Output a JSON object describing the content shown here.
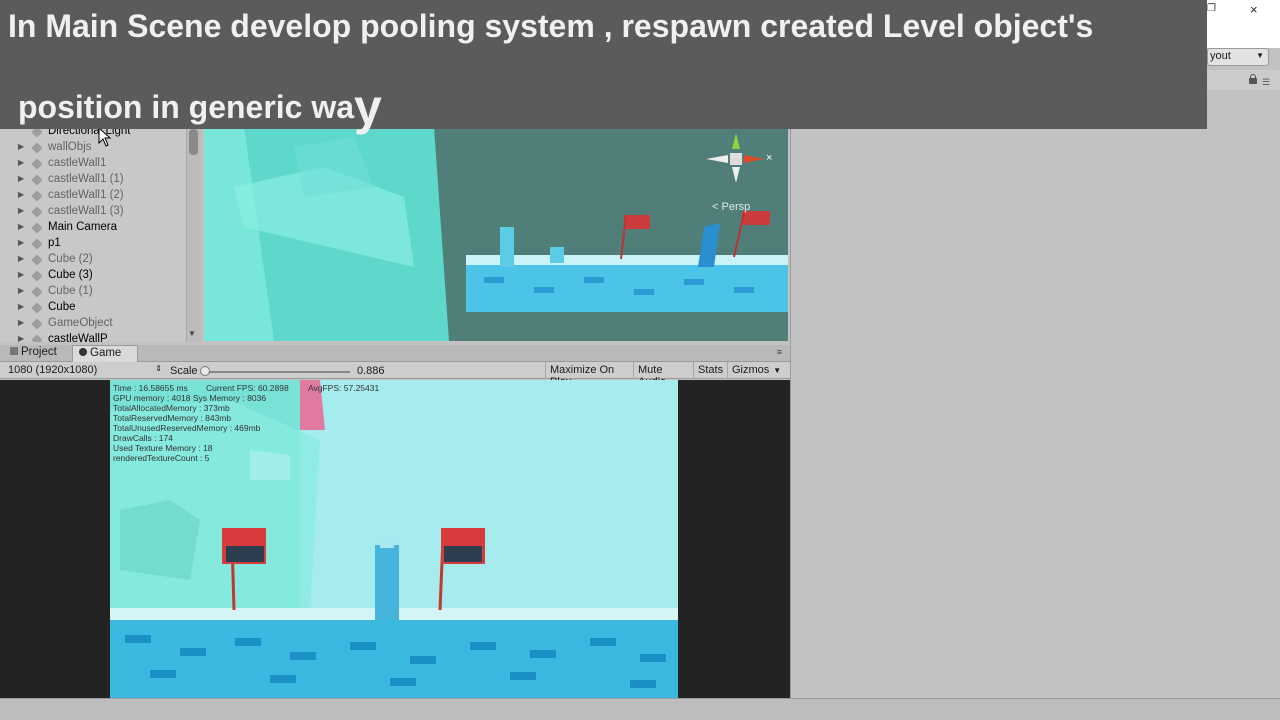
{
  "banner": {
    "line1": "In Main Scene develop pooling system , respawn created Level object's",
    "line2": "position in generic wa",
    "line2_last": "y"
  },
  "window": {
    "layout_label": "yout",
    "close_glyph": "×",
    "restore_glyph": "❐"
  },
  "hierarchy": {
    "items": [
      {
        "label": "Directional Light",
        "style": "bold",
        "arrow": false
      },
      {
        "label": "wallObjs",
        "style": "dim",
        "arrow": true
      },
      {
        "label": "castleWall1",
        "style": "dim",
        "arrow": true
      },
      {
        "label": "castleWall1 (1)",
        "style": "dim",
        "arrow": true
      },
      {
        "label": "castleWall1 (2)",
        "style": "dim",
        "arrow": true
      },
      {
        "label": "castleWall1 (3)",
        "style": "dim",
        "arrow": true
      },
      {
        "label": "Main Camera",
        "style": "bold",
        "arrow": true
      },
      {
        "label": "p1",
        "style": "bold",
        "arrow": true
      },
      {
        "label": "Cube (2)",
        "style": "dim",
        "arrow": true
      },
      {
        "label": "Cube (3)",
        "style": "bold",
        "arrow": true
      },
      {
        "label": "Cube (1)",
        "style": "dim",
        "arrow": true
      },
      {
        "label": "Cube",
        "style": "bold",
        "arrow": true
      },
      {
        "label": "GameObject",
        "style": "dim",
        "arrow": true
      },
      {
        "label": "castleWallP",
        "style": "bold",
        "arrow": true
      }
    ]
  },
  "scene": {
    "persp_label": "Persp"
  },
  "tabs": {
    "project": "Project",
    "game": "Game"
  },
  "game_toolbar": {
    "resolution": "1080 (1920x1080)",
    "scale_label": "Scale",
    "scale_value": "0.886",
    "scale_fraction": 0.0,
    "maximize": "Maximize On Play",
    "mute": "Mute Audio",
    "stats": "Stats",
    "gizmos": "Gizmos"
  },
  "overlay": {
    "time": "Time : 16.58655 ms",
    "current_fps": "Current FPS: 60.2898",
    "avg_fps": "AvgFPS: 57.25431",
    "lines": [
      "GPU memory : 4018    Sys Memory : 8036",
      "TotalAllocatedMemory : 373mb",
      "TotalReservedMemory : 843mb",
      "TotalUnusedReservedMemory : 469mb",
      "DrawCalls : 174",
      "Used Texture Memory : 18",
      "renderedTextureCount : 5"
    ]
  }
}
